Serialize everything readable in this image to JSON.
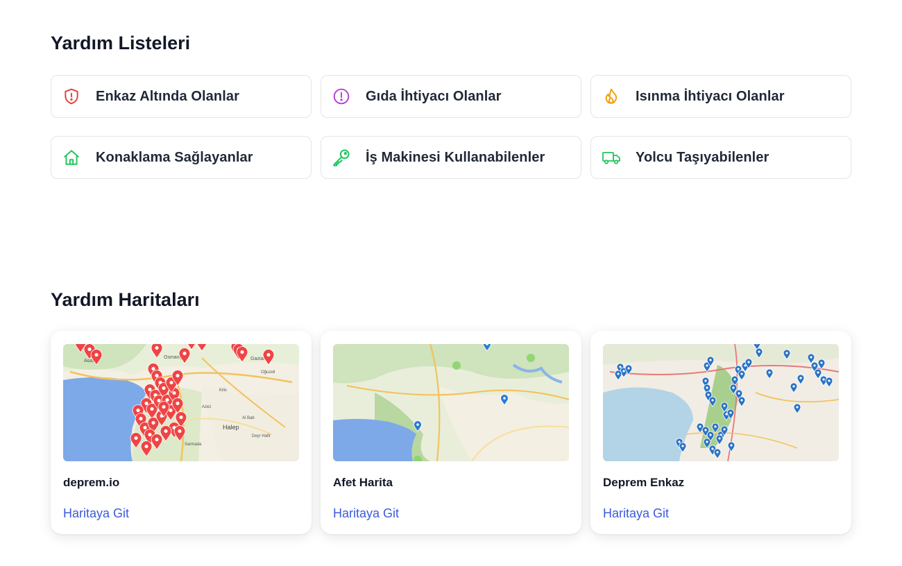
{
  "lists_section": {
    "title": "Yardım Listeleri",
    "items": [
      {
        "label": "Enkaz Altında Olanlar",
        "icon": "shield-alert-icon",
        "color": "#e53e3e"
      },
      {
        "label": "Gıda İhtiyacı Olanlar",
        "icon": "exclamation-circle-icon",
        "color": "#b83bd8"
      },
      {
        "label": "Isınma İhtiyacı Olanlar",
        "icon": "flame-icon",
        "color": "#f59e0b"
      },
      {
        "label": "Konaklama Sağlayanlar",
        "icon": "home-icon",
        "color": "#22c55e"
      },
      {
        "label": "İş Makinesi Kullanabilenler",
        "icon": "key-icon",
        "color": "#22c55e"
      },
      {
        "label": "Yolcu Taşıyabilenler",
        "icon": "truck-icon",
        "color": "#22c55e"
      }
    ]
  },
  "maps_section": {
    "title": "Yardım Haritaları",
    "items": [
      {
        "name": "deprem.io",
        "link": "Haritaya Git",
        "marker_color": "#ef4444",
        "place_labels": [
          "Adana",
          "Osmaniye",
          "Gaziantep",
          "Oğuzeli",
          "Halep",
          "Al Bab",
          "Deyr Hafir",
          "Kilis",
          "Azez",
          "Sarmada"
        ]
      },
      {
        "name": "Afet Harita",
        "link": "Haritaya Git",
        "marker_color": "#2b7bd6",
        "place_labels": []
      },
      {
        "name": "Deprem Enkaz",
        "link": "Haritaya Git",
        "marker_color": "#2a73c5",
        "place_labels": []
      }
    ],
    "link_color": "#3b5bdb"
  }
}
